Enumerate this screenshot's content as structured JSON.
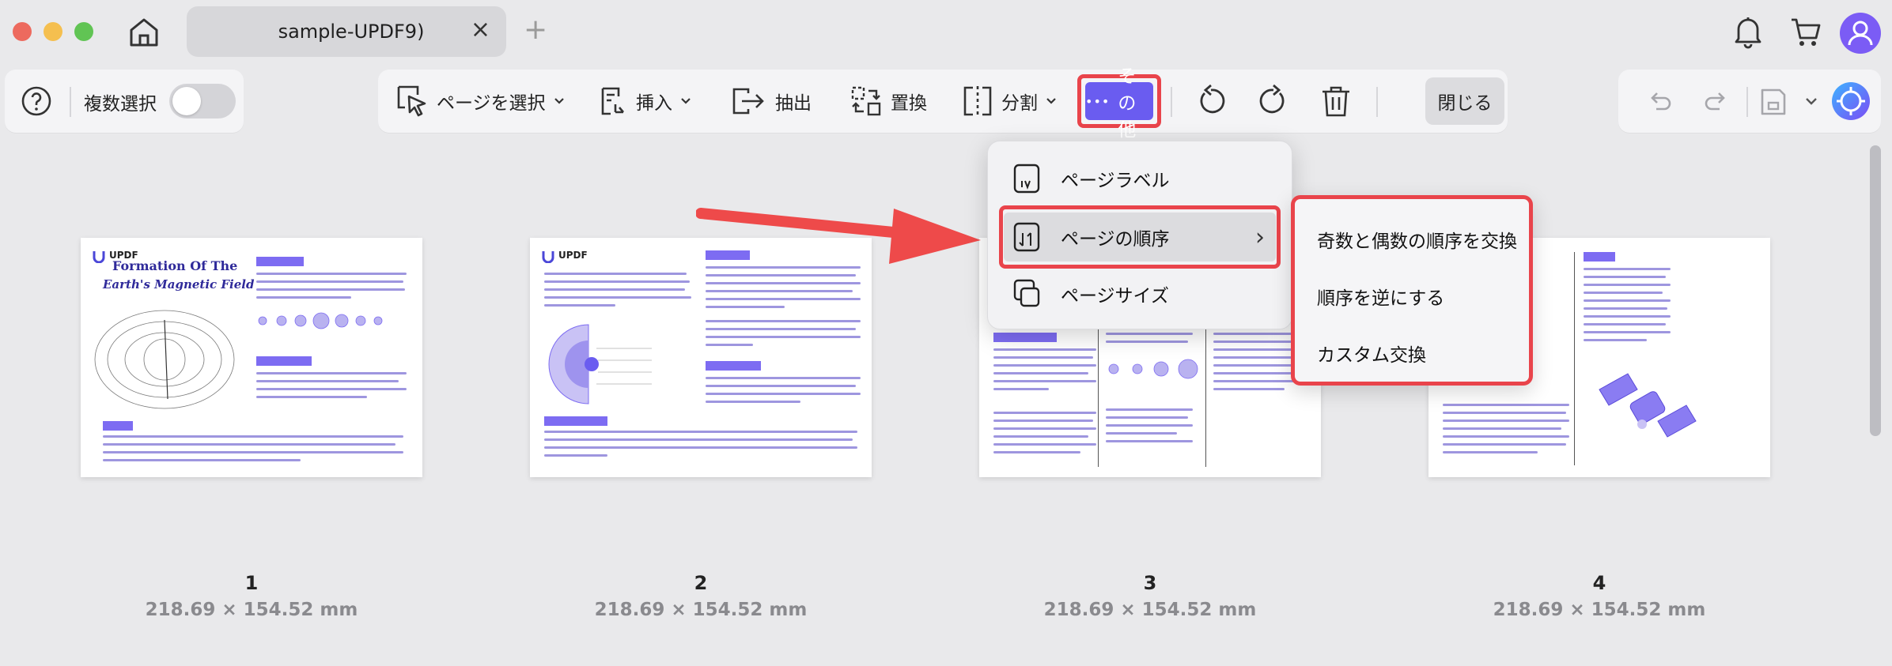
{
  "window": {
    "tab_title": "sample-UPDF9)",
    "tab_close": "×",
    "new_tab": "+"
  },
  "left_toolbar": {
    "help_icon": "question-circle-icon",
    "multi_select_label": "複数選択",
    "multi_select_on": false
  },
  "toolbar": {
    "select_page": "ページを選択",
    "insert": "挿入",
    "extract": "抽出",
    "replace": "置換",
    "split": "分割",
    "more": "その他",
    "more_dots": "•••",
    "close": "閉じる"
  },
  "more_menu": {
    "items": [
      {
        "label": "ページラベル",
        "icon": "page-label-icon"
      },
      {
        "label": "ページの順序",
        "icon": "page-order-icon",
        "has_submenu": true
      },
      {
        "label": "ページサイズ",
        "icon": "page-size-icon"
      }
    ],
    "chevron": "›"
  },
  "order_submenu": {
    "items": [
      {
        "label": "奇数と偶数の順序を交換"
      },
      {
        "label": "順序を逆にする"
      },
      {
        "label": "カスタム交換"
      }
    ]
  },
  "pages": [
    {
      "number": "1",
      "size": "218.69 × 154.52 mm"
    },
    {
      "number": "2",
      "size": "218.69 × 154.52 mm"
    },
    {
      "number": "3",
      "size": "218.69 × 154.52 mm"
    },
    {
      "number": "4",
      "size": "218.69 × 154.52 mm"
    }
  ],
  "thumbnails": {
    "logo_text": "UPDF",
    "page1_title_a": "Formation Of The",
    "page1_title_b": "Earth's Magnetic Field"
  },
  "colors": {
    "accent": "#6a5cf0",
    "highlight_border": "#e9444b",
    "arrow": "#ee4a4a"
  }
}
